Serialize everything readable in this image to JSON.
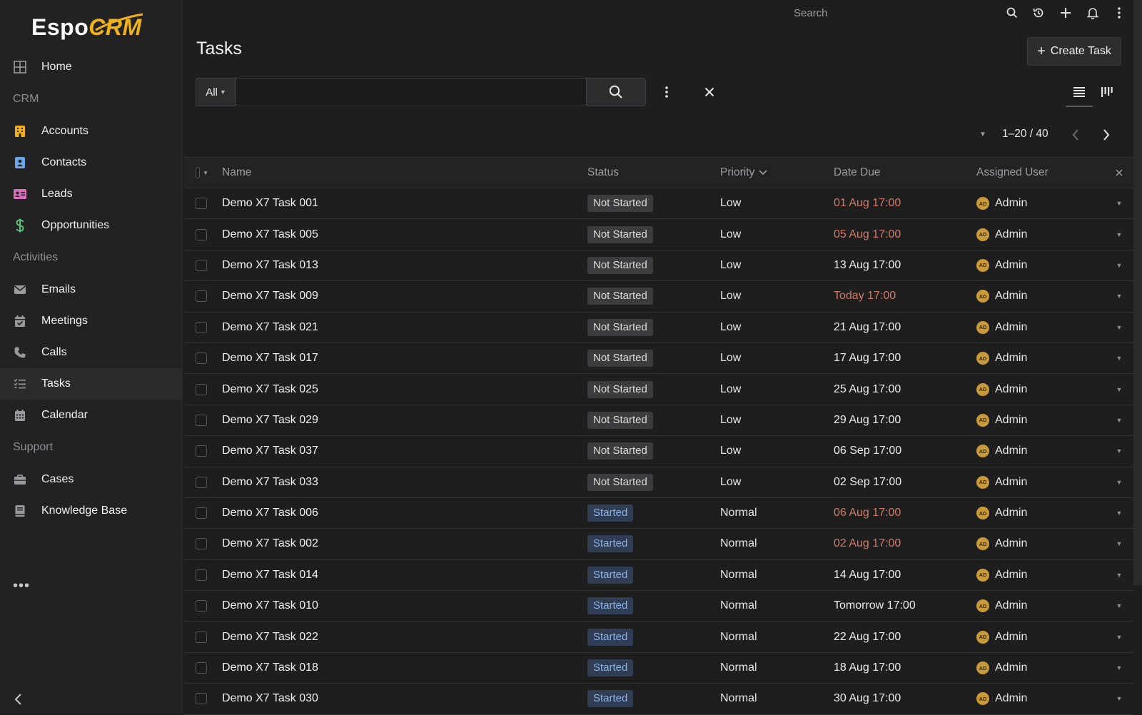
{
  "app": {
    "logo_main": "Espo",
    "logo_accent": "CRM"
  },
  "sidebar": {
    "items": [
      {
        "type": "item",
        "label": "Home",
        "icon": "home-grid-icon",
        "color": "#9a9a9e"
      },
      {
        "type": "group",
        "label": "CRM"
      },
      {
        "type": "item",
        "label": "Accounts",
        "icon": "building-icon",
        "color": "#f0b21a"
      },
      {
        "type": "item",
        "label": "Contacts",
        "icon": "contact-card-icon",
        "color": "#6aa7e8"
      },
      {
        "type": "item",
        "label": "Leads",
        "icon": "id-card-icon",
        "color": "#d46fb8"
      },
      {
        "type": "item",
        "label": "Opportunities",
        "icon": "dollar-icon",
        "color": "#5cc27a"
      },
      {
        "type": "group",
        "label": "Activities"
      },
      {
        "type": "item",
        "label": "Emails",
        "icon": "envelope-icon",
        "color": "#9a9a9e"
      },
      {
        "type": "item",
        "label": "Meetings",
        "icon": "calendar-check-icon",
        "color": "#9a9a9e"
      },
      {
        "type": "item",
        "label": "Calls",
        "icon": "phone-icon",
        "color": "#9a9a9e"
      },
      {
        "type": "item",
        "label": "Tasks",
        "icon": "task-list-icon",
        "color": "#9a9a9e",
        "active": true
      },
      {
        "type": "item",
        "label": "Calendar",
        "icon": "calendar-grid-icon",
        "color": "#9a9a9e"
      },
      {
        "type": "group",
        "label": "Support"
      },
      {
        "type": "item",
        "label": "Cases",
        "icon": "briefcase-icon",
        "color": "#9a9a9e"
      },
      {
        "type": "item",
        "label": "Knowledge Base",
        "icon": "book-icon",
        "color": "#9a9a9e"
      }
    ],
    "more_label": "•••"
  },
  "topbar": {
    "search_placeholder": "Search"
  },
  "main": {
    "title": "Tasks",
    "create_label": "Create Task",
    "filter_label": "All",
    "pager_text": "1–20 / 40"
  },
  "table": {
    "columns": {
      "name": "Name",
      "status": "Status",
      "priority": "Priority",
      "due": "Date Due",
      "user": "Assigned User"
    },
    "rows": [
      {
        "name": "Demo X7 Task 001",
        "status": "Not Started",
        "priority": "Low",
        "due": "01 Aug 17:00",
        "overdue": true,
        "user": "Admin"
      },
      {
        "name": "Demo X7 Task 005",
        "status": "Not Started",
        "priority": "Low",
        "due": "05 Aug 17:00",
        "overdue": true,
        "user": "Admin"
      },
      {
        "name": "Demo X7 Task 013",
        "status": "Not Started",
        "priority": "Low",
        "due": "13 Aug 17:00",
        "overdue": false,
        "user": "Admin"
      },
      {
        "name": "Demo X7 Task 009",
        "status": "Not Started",
        "priority": "Low",
        "due": "Today 17:00",
        "overdue": true,
        "user": "Admin"
      },
      {
        "name": "Demo X7 Task 021",
        "status": "Not Started",
        "priority": "Low",
        "due": "21 Aug 17:00",
        "overdue": false,
        "user": "Admin"
      },
      {
        "name": "Demo X7 Task 017",
        "status": "Not Started",
        "priority": "Low",
        "due": "17 Aug 17:00",
        "overdue": false,
        "user": "Admin"
      },
      {
        "name": "Demo X7 Task 025",
        "status": "Not Started",
        "priority": "Low",
        "due": "25 Aug 17:00",
        "overdue": false,
        "user": "Admin"
      },
      {
        "name": "Demo X7 Task 029",
        "status": "Not Started",
        "priority": "Low",
        "due": "29 Aug 17:00",
        "overdue": false,
        "user": "Admin"
      },
      {
        "name": "Demo X7 Task 037",
        "status": "Not Started",
        "priority": "Low",
        "due": "06 Sep 17:00",
        "overdue": false,
        "user": "Admin"
      },
      {
        "name": "Demo X7 Task 033",
        "status": "Not Started",
        "priority": "Low",
        "due": "02 Sep 17:00",
        "overdue": false,
        "user": "Admin"
      },
      {
        "name": "Demo X7 Task 006",
        "status": "Started",
        "priority": "Normal",
        "due": "06 Aug 17:00",
        "overdue": true,
        "user": "Admin"
      },
      {
        "name": "Demo X7 Task 002",
        "status": "Started",
        "priority": "Normal",
        "due": "02 Aug 17:00",
        "overdue": true,
        "user": "Admin"
      },
      {
        "name": "Demo X7 Task 014",
        "status": "Started",
        "priority": "Normal",
        "due": "14 Aug 17:00",
        "overdue": false,
        "user": "Admin"
      },
      {
        "name": "Demo X7 Task 010",
        "status": "Started",
        "priority": "Normal",
        "due": "Tomorrow 17:00",
        "overdue": false,
        "user": "Admin"
      },
      {
        "name": "Demo X7 Task 022",
        "status": "Started",
        "priority": "Normal",
        "due": "22 Aug 17:00",
        "overdue": false,
        "user": "Admin"
      },
      {
        "name": "Demo X7 Task 018",
        "status": "Started",
        "priority": "Normal",
        "due": "18 Aug 17:00",
        "overdue": false,
        "user": "Admin"
      },
      {
        "name": "Demo X7 Task 030",
        "status": "Started",
        "priority": "Normal",
        "due": "30 Aug 17:00",
        "overdue": false,
        "user": "Admin"
      }
    ]
  }
}
